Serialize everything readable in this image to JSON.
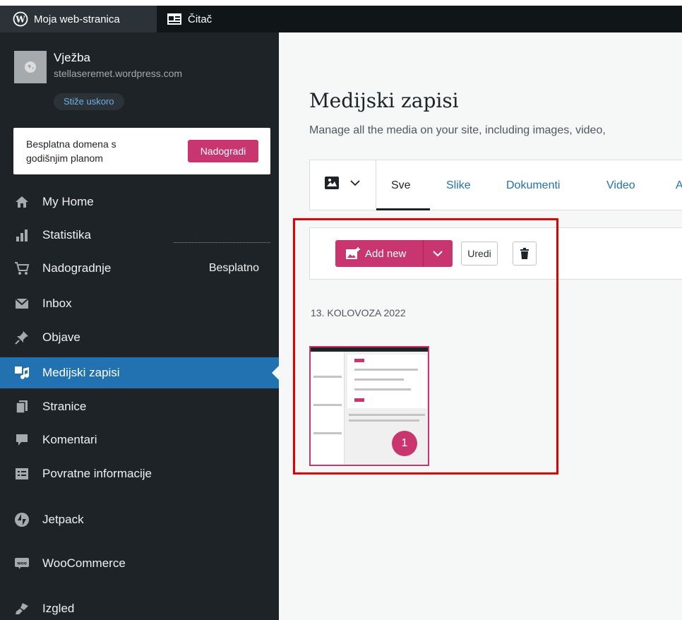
{
  "admin_bar": {
    "site_label": "Moja web-stranica",
    "reader_label": "Čitač"
  },
  "site": {
    "name": "Vježba",
    "url": "stellaseremet.wordpress.com",
    "status_badge": "Stiže uskoro"
  },
  "promo": {
    "text": "Besplatna domena s godišnjim planom",
    "button": "Nadogradi"
  },
  "sidebar": {
    "items": [
      {
        "label": "My Home",
        "icon": "home-icon"
      },
      {
        "label": "Statistika",
        "icon": "stats-icon"
      },
      {
        "label": "Nadogradnje",
        "icon": "cart-icon",
        "right": "Besplatno"
      },
      {
        "label": "Inbox",
        "icon": "mail-icon"
      },
      {
        "label": "Objave",
        "icon": "pin-icon"
      },
      {
        "label": "Medijski zapisi",
        "icon": "media-icon",
        "active": true
      },
      {
        "label": "Stranice",
        "icon": "page-icon"
      },
      {
        "label": "Komentari",
        "icon": "comment-icon"
      },
      {
        "label": "Povratne informacije",
        "icon": "feedback-icon"
      },
      {
        "label": "Jetpack",
        "icon": "jetpack-icon"
      },
      {
        "label": "WooCommerce",
        "icon": "woo-icon"
      },
      {
        "label": "Izgled",
        "icon": "brush-icon"
      }
    ]
  },
  "main": {
    "title": "Medijski zapisi",
    "subtitle": "Manage all the media on your site, including images, video,",
    "tabs": [
      {
        "label": "Sve",
        "active": true
      },
      {
        "label": "Slike"
      },
      {
        "label": "Dokumenti"
      },
      {
        "label": "Video"
      },
      {
        "label": "A"
      }
    ],
    "actions": {
      "add_new": "Add new",
      "edit": "Uredi"
    },
    "date_heading": "13. KOLOVOZA 2022",
    "thumbnail_count": "1"
  },
  "colors": {
    "accent_pink": "#c9356e",
    "active_blue": "#2271b1",
    "sidebar_bg": "#1d2327",
    "highlight_red": "#e50000"
  }
}
